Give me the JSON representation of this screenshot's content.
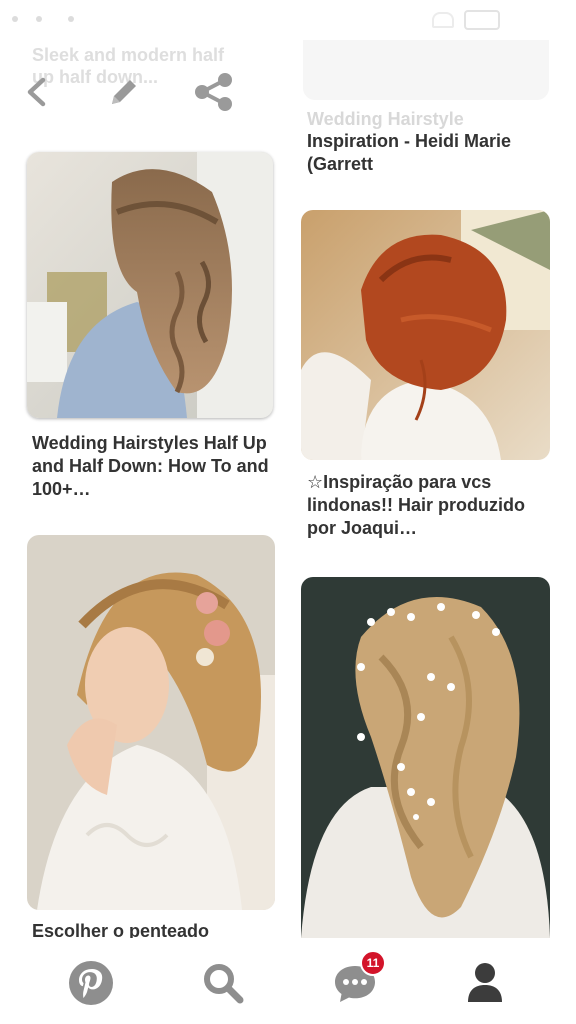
{
  "header": {
    "ghost_left_title": "Sleek and modern half up half down...",
    "ghost_right_title": "Wedding Hairstyle Inspiration"
  },
  "pins": [
    {
      "title": "Inspiration - Heidi Marie (Garrett"
    },
    {
      "title": "Wedding Hairstyles Half Up and Half Down: How To and 100+…"
    },
    {
      "title": "☆Inspiração para vcs lindonas!! Hair produzido por Joaqui…"
    },
    {
      "title": "Escolher o penteado"
    }
  ],
  "nav": {
    "messages_badge": "11"
  },
  "icons": {
    "back": "chevron-left-icon",
    "edit": "pencil-icon",
    "share": "share-icon",
    "home": "pinterest-logo-icon",
    "search": "search-icon",
    "messages": "chat-bubble-icon",
    "profile": "person-icon"
  },
  "colors": {
    "text": "#333333",
    "icon_gray": "#8e8e8e",
    "badge": "#d3142a"
  }
}
